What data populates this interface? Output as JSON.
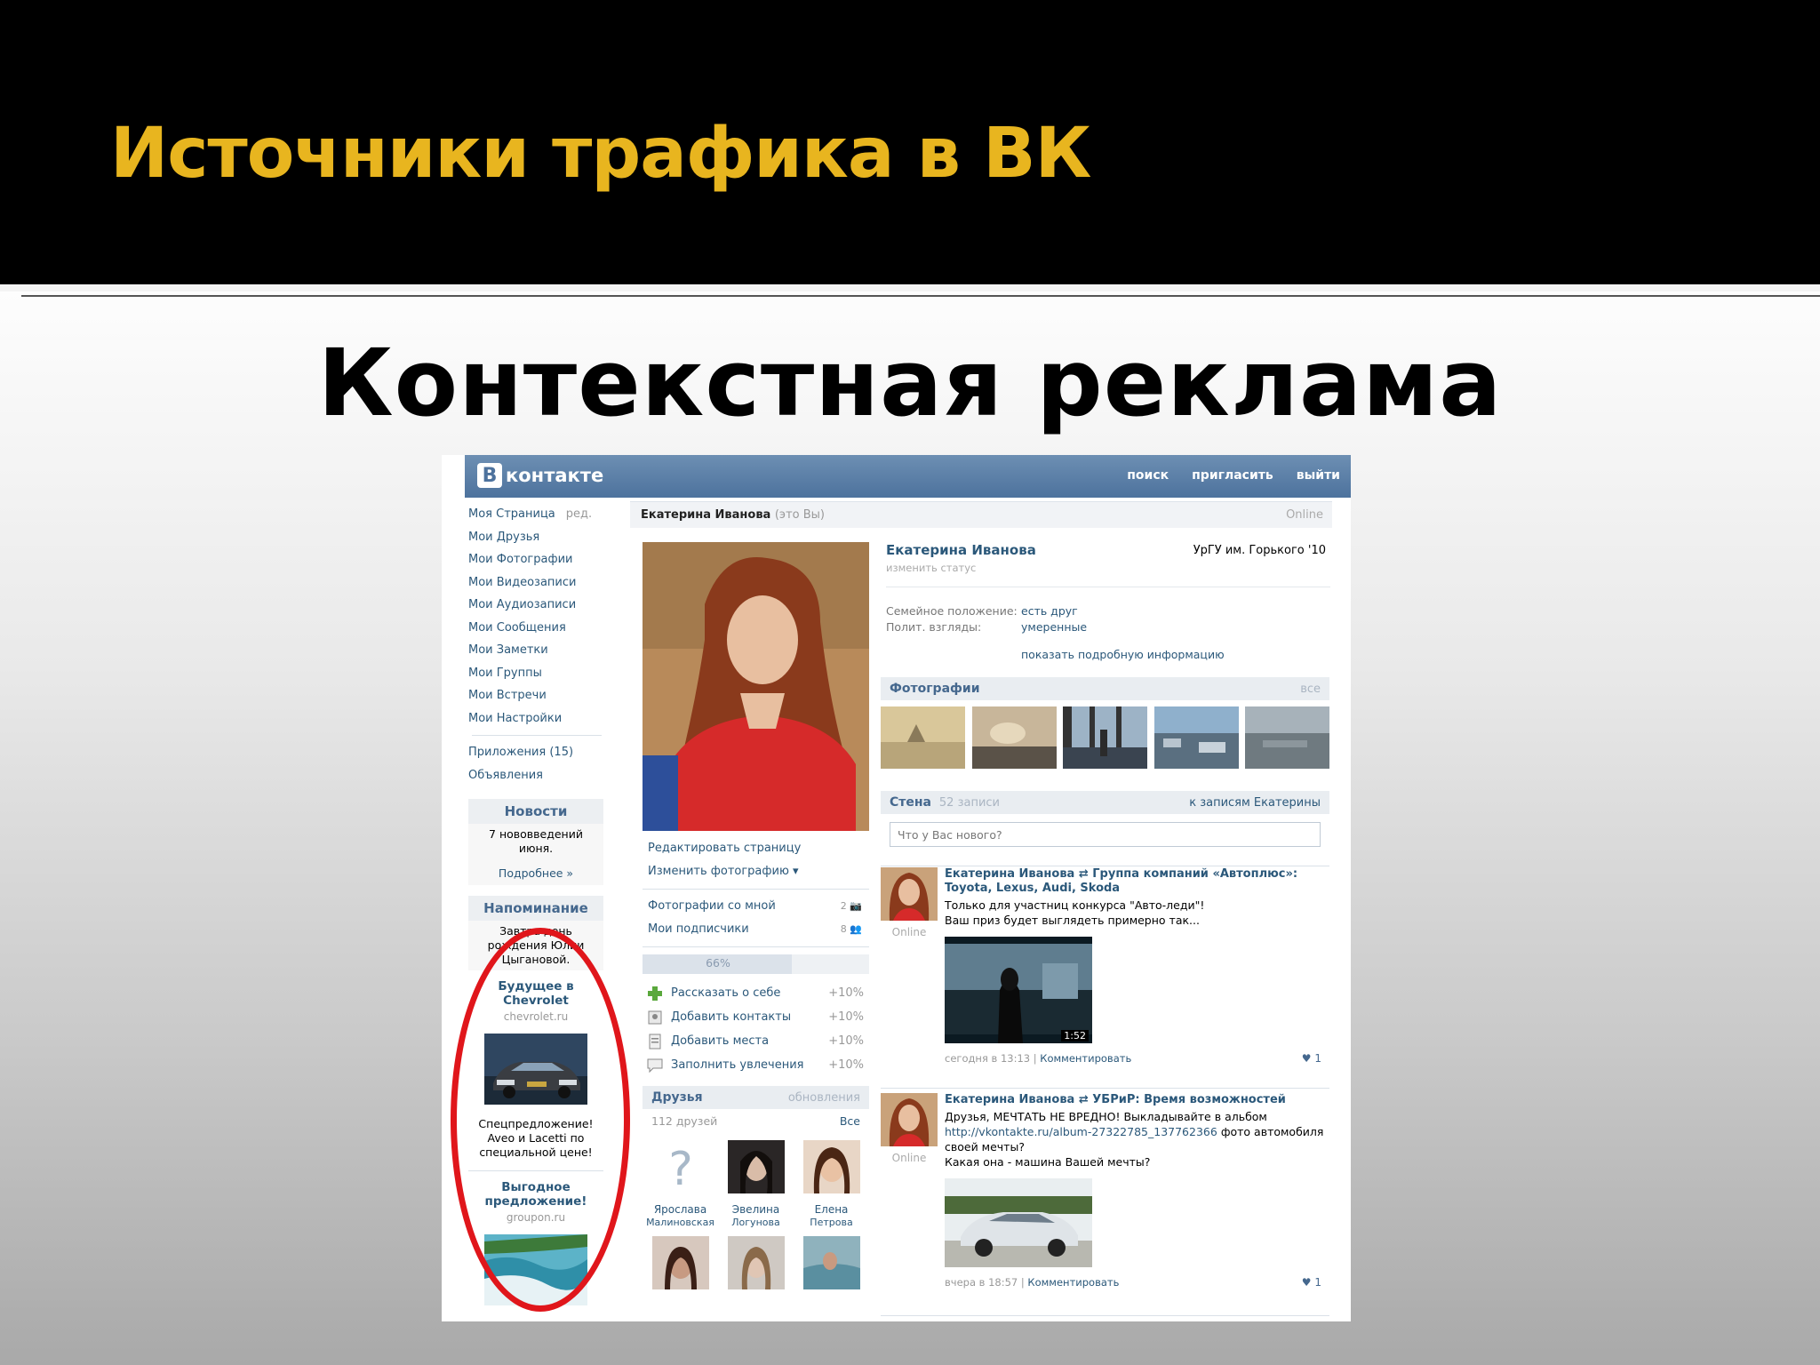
{
  "slide": {
    "title": "Источники трафика в ВК",
    "subtitle": "Контекстная реклама"
  },
  "vk": {
    "logo_letter": "В",
    "logo_text": "контакте",
    "topnav": [
      "поиск",
      "пригласить",
      "выйти"
    ],
    "menu": [
      "Моя Страница",
      "Мои Друзья",
      "Мои Фотографии",
      "Мои Видеозаписи",
      "Мои Аудиозаписи",
      "Мои Сообщения",
      "Мои Заметки",
      "Мои Группы",
      "Мои Встречи",
      "Мои Настройки"
    ],
    "menu_edit": "ред.",
    "menu_extra": [
      "Приложения (15)",
      "Объявления"
    ],
    "news": {
      "title": "Новости",
      "text": "7 нововведений июня.",
      "link": "Подробнее »"
    },
    "reminder": {
      "title": "Напоминание",
      "text": "Завтра день рождения Юлии Цыгановой."
    },
    "ads": [
      {
        "title": "Будущее в Chevrolet",
        "domain": "chevrolet.ru",
        "text": "Спецпредложение! Aveo и Lacetti по специальной цене!"
      },
      {
        "title": "Выгодное предложение!",
        "domain": "groupon.ru",
        "text": ""
      }
    ],
    "profile": {
      "name": "Екатерина Иванова",
      "you": "(это Вы)",
      "online": "Online",
      "status_hint": "изменить статус",
      "university": "УрГУ им. Горького '10",
      "info": [
        {
          "k": "Семейное положение:",
          "v": "есть друг"
        },
        {
          "k": "Полит. взгляды:",
          "v": "умеренные"
        }
      ],
      "more": "показать подробную информацию"
    },
    "left_links": [
      "Редактировать страницу",
      "Изменить фотографию ▾"
    ],
    "counts": [
      {
        "label": "Фотографии со мной",
        "n": "2"
      },
      {
        "label": "Мои подписчики",
        "n": "8"
      }
    ],
    "progress": {
      "label": "66%",
      "value": 0.66
    },
    "tasks": [
      {
        "label": "Рассказать о себе",
        "pct": "+10%"
      },
      {
        "label": "Добавить контакты",
        "pct": "+10%"
      },
      {
        "label": "Добавить места",
        "pct": "+10%"
      },
      {
        "label": "Заполнить увлечения",
        "pct": "+10%"
      }
    ],
    "friends": {
      "title": "Друзья",
      "updates": "обновления",
      "count": "112 друзей",
      "all": "Все",
      "list": [
        {
          "first": "Ярослава",
          "last": "Малиновская"
        },
        {
          "first": "Эвелина",
          "last": "Логунова"
        },
        {
          "first": "Елена",
          "last": "Петрова"
        }
      ]
    },
    "photos": {
      "title": "Фотографии",
      "all": "все"
    },
    "wall": {
      "title": "Стена",
      "count": "52 записи",
      "link": "к записям Екатерины",
      "placeholder": "Что у Вас нового?"
    },
    "posts": [
      {
        "author": "Екатерина Иванова ⇄ Группа компаний «Автоплюс»: Toyota, Lexus, Audi, Skoda",
        "line1": "Только для участниц конкурса \"Авто-леди\"!",
        "line2": "Ваш приз будет выглядеть примерно так...",
        "online": "Online",
        "duration": "1:52",
        "time": "сегодня в 13:13",
        "comment": "Комментировать",
        "likes": "1"
      },
      {
        "author": "Екатерина Иванова ⇄ УБРиР: Время возможностей",
        "line1": "Друзья, МЕЧТАТЬ НЕ ВРЕДНО! Выкладывайте в альбом",
        "link": "http://vkontakte.ru/album-27322785_137762366",
        "line2": "фото автомобиля своей мечты?",
        "line3": "Какая она - машина Вашей мечты?",
        "online": "Online",
        "time": "вчера в 18:57",
        "comment": "Комментировать",
        "likes": "1"
      }
    ]
  }
}
